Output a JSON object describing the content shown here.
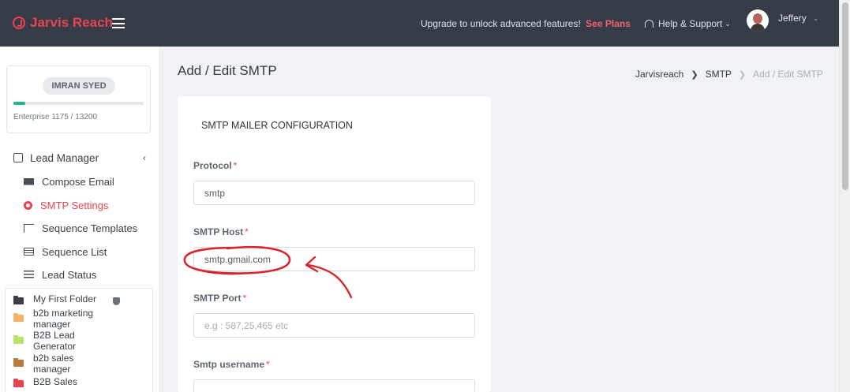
{
  "header": {
    "brand": "Jarvis Reach",
    "upgrade_text": "Upgrade to unlock advanced features!",
    "upgrade_link": "See Plans",
    "help_label": "Help & Support",
    "user_name": "Jeffery"
  },
  "sidebar": {
    "account": {
      "name": "IMRAN SYED",
      "plan_text": "Enterprise 1175 / 13200",
      "usage_fraction": 0.089
    },
    "section": "Lead Manager",
    "items": [
      {
        "label": "Compose Email",
        "icon": "mail-icon",
        "active": false
      },
      {
        "label": "SMTP Settings",
        "icon": "gear-icon",
        "active": true
      },
      {
        "label": "Sequence Templates",
        "icon": "sequence-icon",
        "active": false
      },
      {
        "label": "Sequence List",
        "icon": "list-icon",
        "active": false
      },
      {
        "label": "Lead Status",
        "icon": "status-list-icon",
        "active": false
      }
    ],
    "folders": [
      {
        "label": "My First Folder",
        "color": "#3b4048"
      },
      {
        "label": "b2b marketing manager",
        "color": "#f7b267"
      },
      {
        "label": "B2B Lead Generator",
        "color": "#b6e36b"
      },
      {
        "label": "b2b sales manager",
        "color": "#b97a3c"
      },
      {
        "label": "B2B Sales",
        "color": "#e8434f"
      }
    ]
  },
  "main": {
    "page_title": "Add / Edit SMTP",
    "breadcrumb": [
      "Jarvisreach",
      "SMTP",
      "Add / Edit SMTP"
    ],
    "form": {
      "title": "SMTP MAILER CONFIGURATION",
      "fields": [
        {
          "label": "Protocol",
          "required": "*",
          "value": "smtp",
          "placeholder": ""
        },
        {
          "label": "SMTP Host",
          "required": "*",
          "value": "smtp.gmail.com",
          "placeholder": ""
        },
        {
          "label": "SMTP Port",
          "required": "*",
          "value": "",
          "placeholder": "e.g : 587,25,465 etc"
        },
        {
          "label": "Smtp username",
          "required": "*",
          "value": "",
          "placeholder": ""
        }
      ]
    }
  },
  "colors": {
    "header_bg": "#353c47",
    "accent": "#e8434f",
    "progress": "#1eb98a",
    "annotation": "#d9262e"
  }
}
